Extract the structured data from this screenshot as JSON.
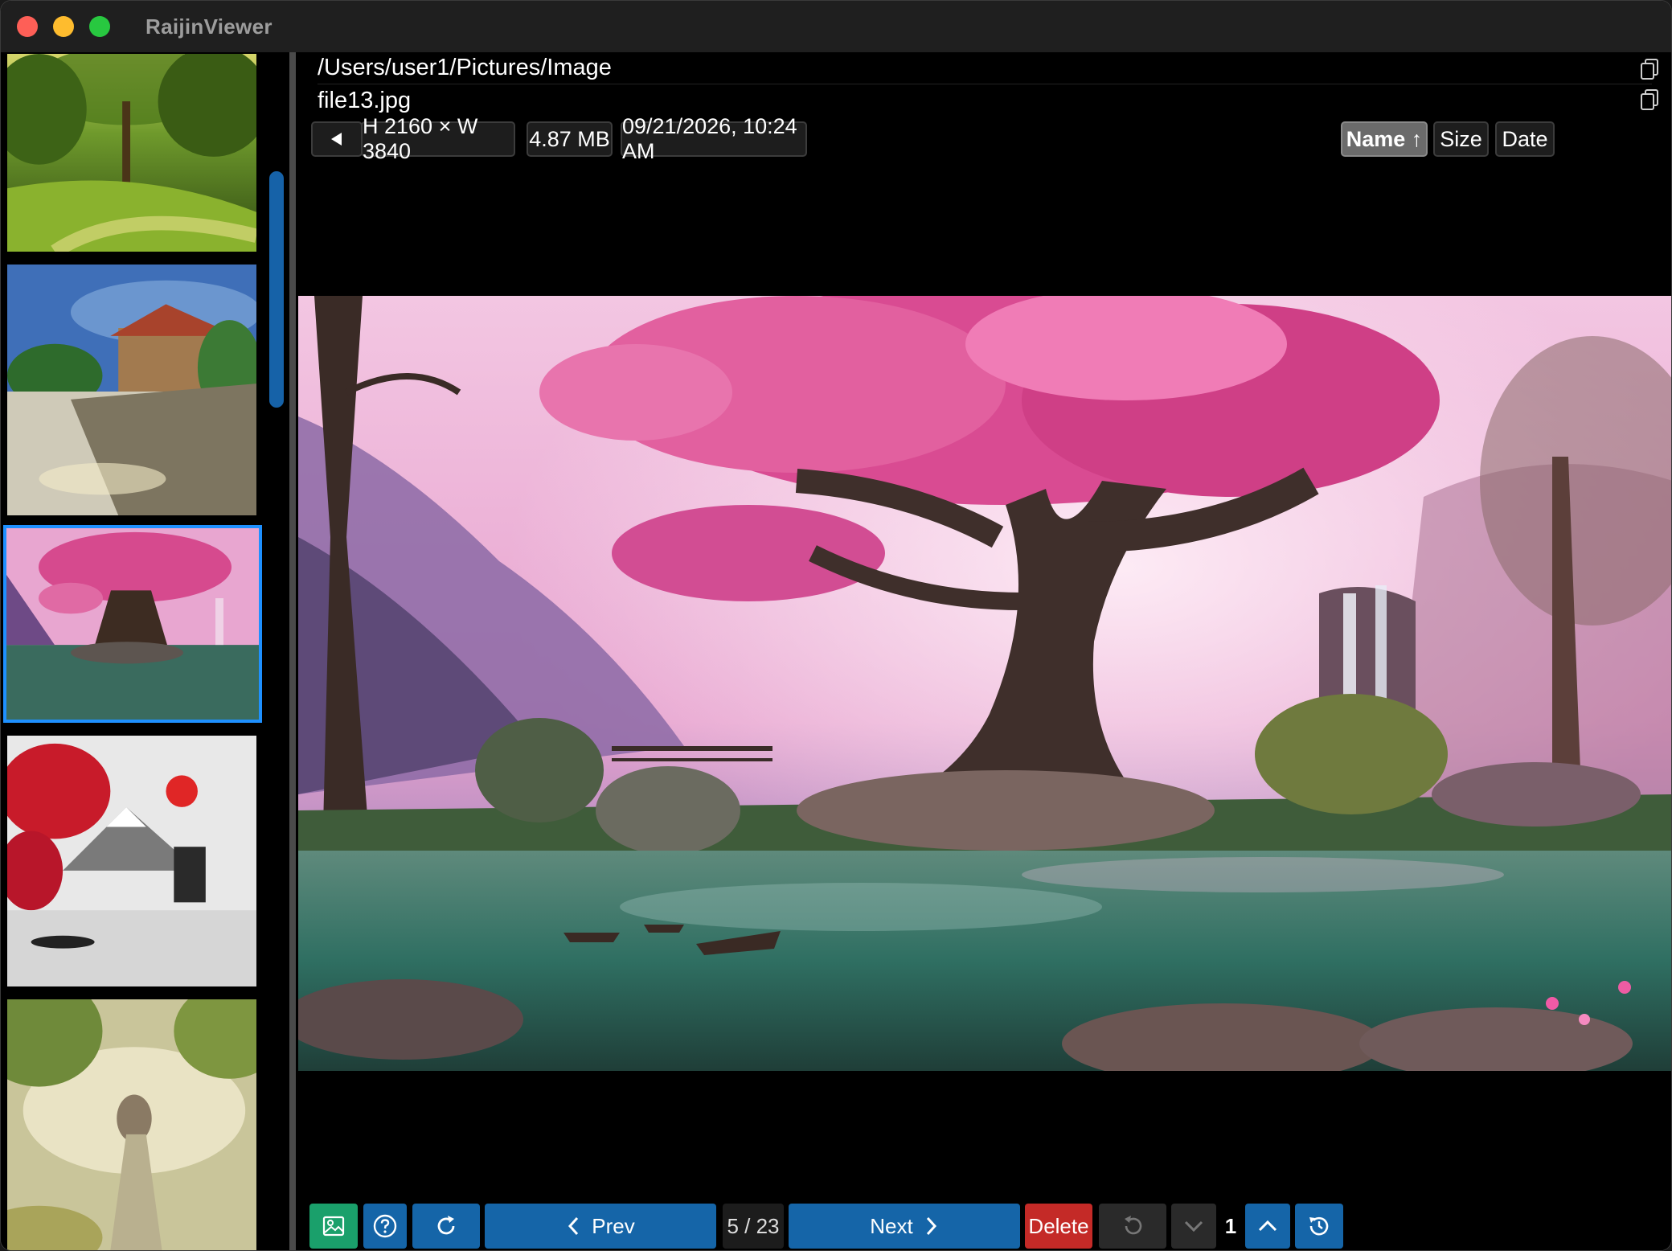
{
  "app": {
    "title": "RaijinViewer"
  },
  "path": {
    "directory": "/Users/user1/Pictures/Image",
    "filename": "file13.jpg"
  },
  "info": {
    "back_icon": "triangle-left",
    "dimensions": "H 2160 × W 3840",
    "size": "4.87 MB",
    "date": "09/21/2026, 10:24 AM"
  },
  "sort": {
    "name": "Name ↑",
    "size": "Size",
    "date": "Date",
    "active": "name"
  },
  "thumbnails": [
    {
      "name": "forest-path",
      "selected": false
    },
    {
      "name": "village-road",
      "selected": false
    },
    {
      "name": "pink-tree-lake",
      "selected": true
    },
    {
      "name": "fuji-red-maple",
      "selected": false
    },
    {
      "name": "girl-clouds",
      "selected": false
    }
  ],
  "toolbar": {
    "prev_label": "Prev",
    "next_label": "Next",
    "counter": "5 / 23",
    "delete_label": "Delete",
    "page_number": "1"
  },
  "colors": {
    "accent": "#1565a8",
    "selection": "#1e90ff",
    "delete": "#c42a27",
    "gallery": "#1aa06b"
  }
}
